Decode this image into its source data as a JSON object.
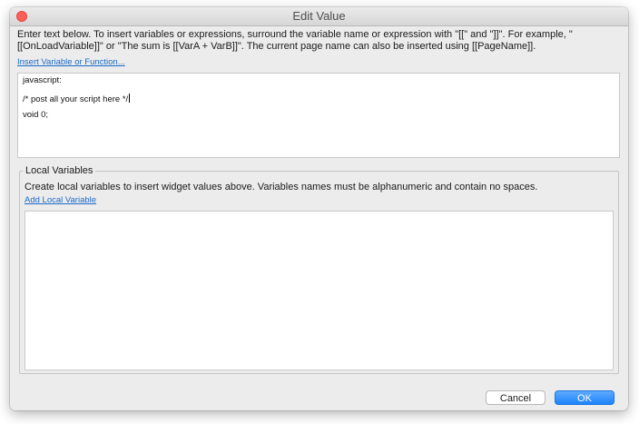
{
  "window": {
    "title": "Edit Value"
  },
  "intro_text": "Enter text below. To insert variables or expressions, surround the variable name or expression with \"[[\" and \"]]\". For example, \"[[OnLoadVariable]]\" or \"The sum is [[VarA + VarB]]\". The current page name can also be inserted using [[PageName]].",
  "insert_link": "Insert Variable or Function...",
  "script": {
    "line1": "javascript:",
    "line2": "/* post all your script here */",
    "line3": "void 0;"
  },
  "local_variables": {
    "legend": "Local Variables",
    "description": "Create local variables to insert widget values above. Variables names must be alphanumeric and contain no spaces.",
    "add_link": "Add Local Variable"
  },
  "buttons": {
    "cancel": "Cancel",
    "ok": "OK"
  },
  "colors": {
    "close_button": "#fc5f57",
    "ok_button": "#1d84fb",
    "link": "#1b6ac9"
  }
}
